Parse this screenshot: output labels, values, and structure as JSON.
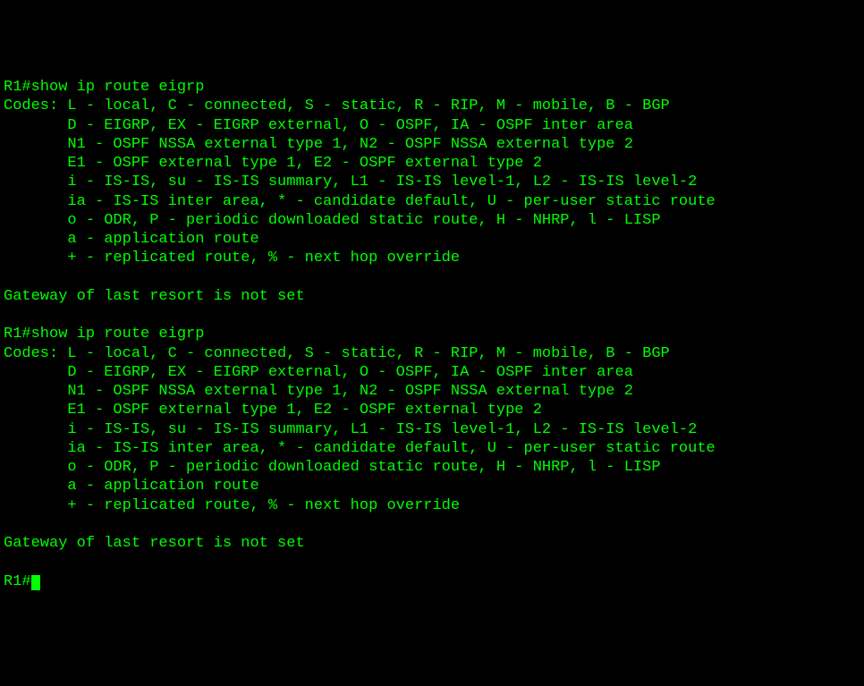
{
  "terminal": {
    "lines": [
      "R1#show ip route eigrp",
      "Codes: L - local, C - connected, S - static, R - RIP, M - mobile, B - BGP",
      "       D - EIGRP, EX - EIGRP external, O - OSPF, IA - OSPF inter area",
      "       N1 - OSPF NSSA external type 1, N2 - OSPF NSSA external type 2",
      "       E1 - OSPF external type 1, E2 - OSPF external type 2",
      "       i - IS-IS, su - IS-IS summary, L1 - IS-IS level-1, L2 - IS-IS level-2",
      "       ia - IS-IS inter area, * - candidate default, U - per-user static route",
      "       o - ODR, P - periodic downloaded static route, H - NHRP, l - LISP",
      "       a - application route",
      "       + - replicated route, % - next hop override",
      "",
      "Gateway of last resort is not set",
      "",
      "R1#show ip route eigrp",
      "Codes: L - local, C - connected, S - static, R - RIP, M - mobile, B - BGP",
      "       D - EIGRP, EX - EIGRP external, O - OSPF, IA - OSPF inter area",
      "       N1 - OSPF NSSA external type 1, N2 - OSPF NSSA external type 2",
      "       E1 - OSPF external type 1, E2 - OSPF external type 2",
      "       i - IS-IS, su - IS-IS summary, L1 - IS-IS level-1, L2 - IS-IS level-2",
      "       ia - IS-IS inter area, * - candidate default, U - per-user static route",
      "       o - ODR, P - periodic downloaded static route, H - NHRP, l - LISP",
      "       a - application route",
      "       + - replicated route, % - next hop override",
      "",
      "Gateway of last resort is not set",
      ""
    ],
    "prompt": "R1#"
  }
}
